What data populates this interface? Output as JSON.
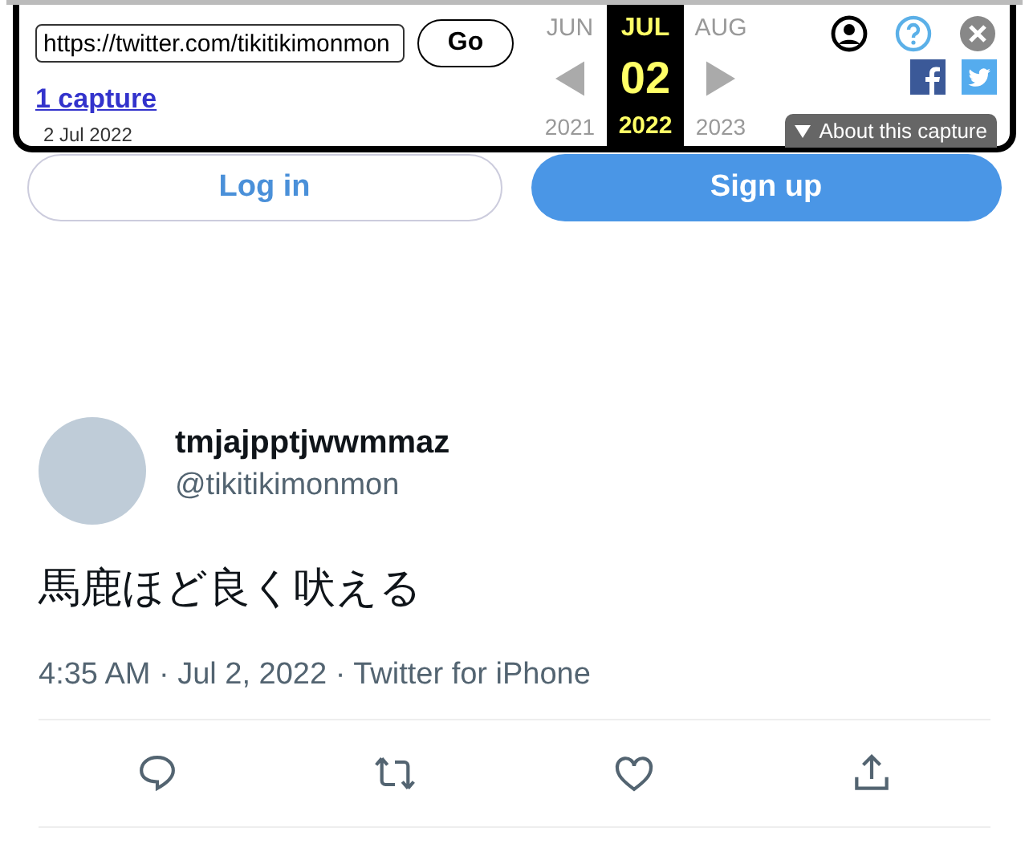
{
  "wayback_toolbar": {
    "url": "https://twitter.com/tikitikimonmon",
    "go_button": "Go",
    "captures_link": "1 capture",
    "capture_date": "2 Jul 2022",
    "months": [
      {
        "month": "JUN",
        "year": "2021",
        "selected": false
      },
      {
        "month": "JUL",
        "day": "02",
        "year": "2022",
        "selected": true
      },
      {
        "month": "AUG",
        "year": "2023",
        "selected": false
      }
    ],
    "about_tab": "About this capture"
  },
  "auth_buttons": [
    {
      "label": "Log in",
      "kind": "outline"
    },
    {
      "label": "Sign up",
      "kind": "filled"
    }
  ],
  "tweet": {
    "display_name": "tmjajpptjwwmmaz",
    "handle": "@tikitikimonmon",
    "text": "馬鹿ほど良く吠える",
    "meta": "4:35 AM · Jul 2, 2022 · Twitter for iPhone",
    "actions": [
      {
        "kind": "reply"
      },
      {
        "kind": "retweet"
      },
      {
        "kind": "like"
      },
      {
        "kind": "share"
      }
    ]
  }
}
